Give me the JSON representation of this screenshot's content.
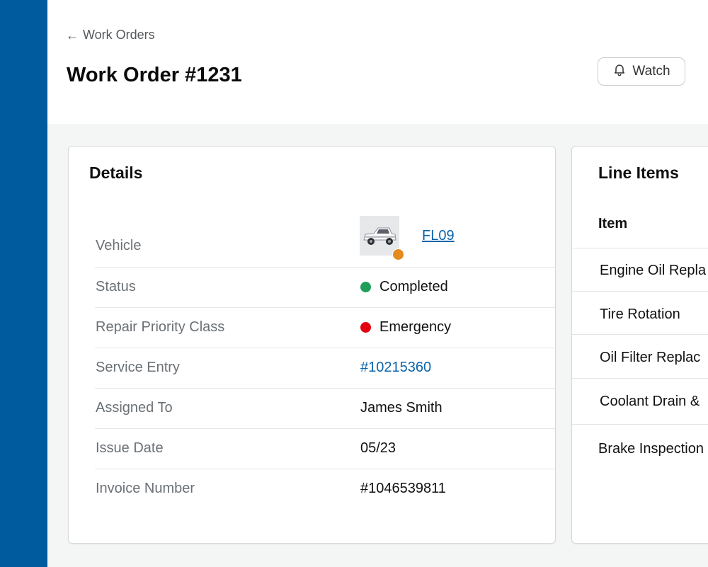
{
  "nav": {
    "back_label": "Work Orders"
  },
  "page": {
    "title": "Work Order #1231"
  },
  "actions": {
    "watch_label": "Watch"
  },
  "colors": {
    "sidebar": "#005a9e",
    "link": "#0a64a8",
    "status_completed": "#1e9e5a",
    "status_emergency": "#e3000f",
    "vehicle_badge": "#e58a1f"
  },
  "details": {
    "title": "Details",
    "rows": [
      {
        "label": "Vehicle",
        "value": "FL09"
      },
      {
        "label": "Status",
        "value": "Completed"
      },
      {
        "label": "Repair Priority Class",
        "value": "Emergency"
      },
      {
        "label": "Service Entry",
        "value": "#10215360"
      },
      {
        "label": "Assigned To",
        "value": "James Smith"
      },
      {
        "label": "Issue Date",
        "value": "05/23"
      },
      {
        "label": "Invoice Number",
        "value": "#1046539811"
      }
    ]
  },
  "line_items": {
    "title": "Line Items",
    "column_header": "Item",
    "items": [
      "Engine Oil Repla",
      "Tire Rotation",
      "Oil Filter Replac",
      "Coolant Drain &",
      "Brake Inspection"
    ]
  }
}
